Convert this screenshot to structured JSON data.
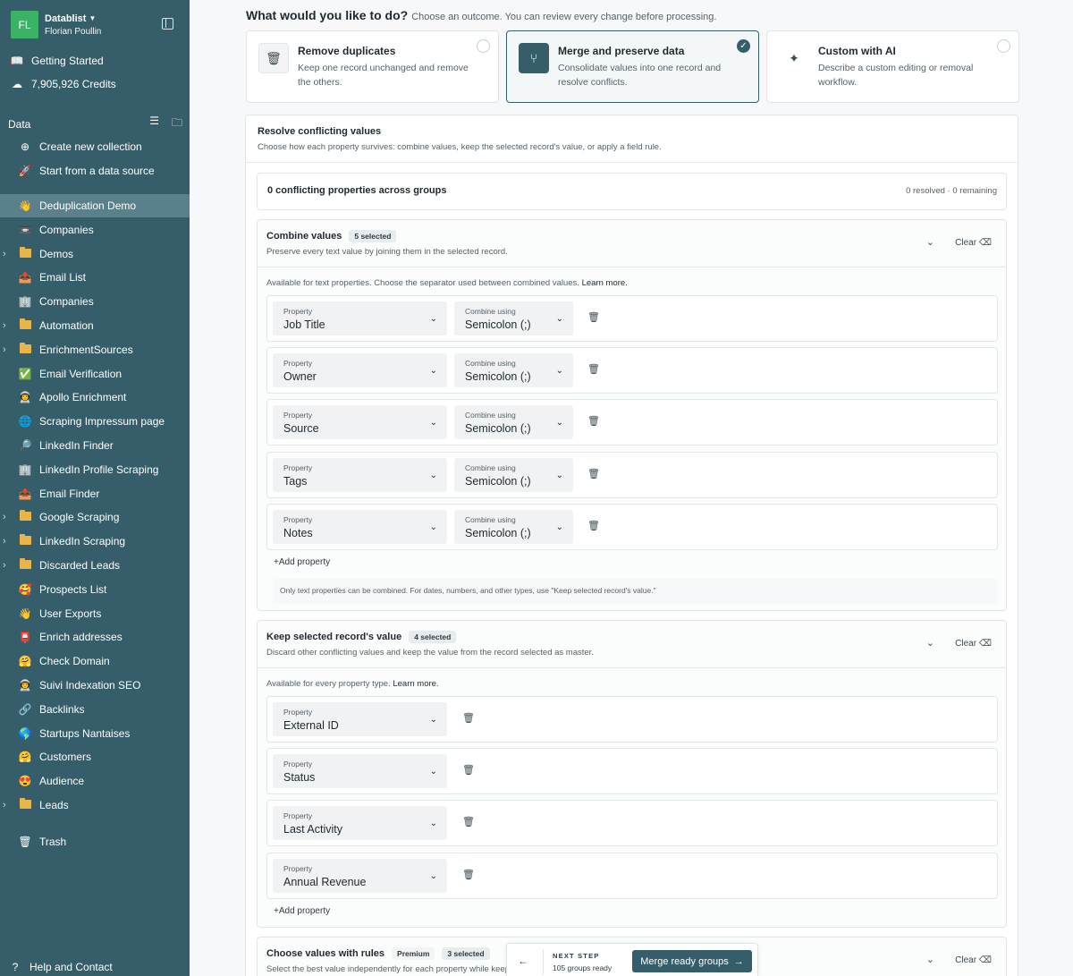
{
  "sidebar": {
    "workspace": {
      "initials": "FL",
      "name": "Datablist",
      "user": "Florian Poullin"
    },
    "getting_started": "Getting Started",
    "credits": "7,905,926 Credits",
    "section_title": "Data",
    "create_collection": "Create new collection",
    "start_source": "Start from a data source",
    "items": [
      {
        "label": "Deduplication Demo",
        "icon": "👋",
        "folder": false,
        "active": true
      },
      {
        "label": "Companies",
        "icon": "📼",
        "folder": false
      },
      {
        "label": "Demos",
        "icon": "",
        "folder": true
      },
      {
        "label": "Email List",
        "icon": "📤",
        "folder": false
      },
      {
        "label": "Companies",
        "icon": "🏢",
        "folder": false
      },
      {
        "label": "Automation",
        "icon": "",
        "folder": true
      },
      {
        "label": "EnrichmentSources",
        "icon": "",
        "folder": true
      },
      {
        "label": "Email Verification",
        "icon": "✅",
        "folder": false
      },
      {
        "label": "Apollo Enrichment",
        "icon": "👨‍🚀",
        "folder": false
      },
      {
        "label": "Scraping Impressum page",
        "icon": "🌐",
        "folder": false
      },
      {
        "label": "LinkedIn Finder",
        "icon": "🔎",
        "folder": false
      },
      {
        "label": "LinkedIn Profile Scraping",
        "icon": "🏢",
        "folder": false
      },
      {
        "label": "Email Finder",
        "icon": "📤",
        "folder": false
      },
      {
        "label": "Google Scraping",
        "icon": "",
        "folder": true
      },
      {
        "label": "LinkedIn Scraping",
        "icon": "",
        "folder": true
      },
      {
        "label": "Discarded Leads",
        "icon": "",
        "folder": true
      },
      {
        "label": "Prospects List",
        "icon": "🥰",
        "folder": false
      },
      {
        "label": "User Exports",
        "icon": "👋",
        "folder": false
      },
      {
        "label": "Enrich addresses",
        "icon": "📮",
        "folder": false
      },
      {
        "label": "Check Domain",
        "icon": "🤗",
        "folder": false
      },
      {
        "label": "Suivi Indexation SEO",
        "icon": "👨‍🚀",
        "folder": false
      },
      {
        "label": "Backlinks",
        "icon": "🔗",
        "folder": false
      },
      {
        "label": "Startups Nantaises",
        "icon": "🌎",
        "folder": false
      },
      {
        "label": "Customers",
        "icon": "🤗",
        "folder": false
      },
      {
        "label": "Audience",
        "icon": "😍",
        "folder": false
      },
      {
        "label": "Leads",
        "icon": "",
        "folder": true
      }
    ],
    "trash": "Trash",
    "help": "Help and Contact"
  },
  "main": {
    "question": "What would you like to do?",
    "question_sub": "Choose an outcome. You can review every change before processing.",
    "options": [
      {
        "title": "Remove duplicates",
        "desc": "Keep one record unchanged and remove the others.",
        "selected": false
      },
      {
        "title": "Merge and preserve data",
        "desc": "Consolidate values into one record and resolve conflicts.",
        "selected": true
      },
      {
        "title": "Custom with AI",
        "desc": "Describe a custom editing or removal workflow.",
        "selected": false
      }
    ],
    "panel": {
      "title": "Resolve conflicting values",
      "subtitle": "Choose how each property survives: combine values, keep the selected record's value, or apply a field rule.",
      "summary_left": "0 conflicting properties across groups",
      "summary_right": "0 resolved · 0 remaining"
    },
    "combine": {
      "title": "Combine values",
      "badge": "5 selected",
      "subtitle": "Preserve every text value by joining them in the selected record.",
      "clear": "Clear",
      "avail": "Available for text properties. Choose the separator used between combined values.",
      "learn_more": "Learn more.",
      "prop_label": "Property",
      "combine_label": "Combine using",
      "rows": [
        {
          "property": "Job Title",
          "separator": "Semicolon (;)"
        },
        {
          "property": "Owner",
          "separator": "Semicolon (;)"
        },
        {
          "property": "Source",
          "separator": "Semicolon (;)"
        },
        {
          "property": "Tags",
          "separator": "Semicolon (;)"
        },
        {
          "property": "Notes",
          "separator": "Semicolon (;)"
        }
      ],
      "add": "Add property",
      "note": "Only text properties can be combined. For dates, numbers, and other types, use \"Keep selected record's value.\""
    },
    "keep": {
      "title": "Keep selected record's value",
      "badge": "4 selected",
      "subtitle": "Discard other conflicting values and keep the value from the record selected as master.",
      "clear": "Clear",
      "avail": "Available for every property type.",
      "learn_more": "Learn more.",
      "prop_label": "Property",
      "rows": [
        {
          "property": "External ID"
        },
        {
          "property": "Status"
        },
        {
          "property": "Last Activity"
        },
        {
          "property": "Annual Revenue"
        }
      ],
      "add": "Add property"
    },
    "rules": {
      "title": "Choose values with rules",
      "premium": "Premium",
      "badge": "3 selected",
      "subtitle": "Select the best value independently for each property while keep",
      "clear": "Clear"
    },
    "next_step": {
      "label": "NEXT STEP",
      "count": "105 groups ready",
      "button": "Merge ready groups"
    }
  }
}
